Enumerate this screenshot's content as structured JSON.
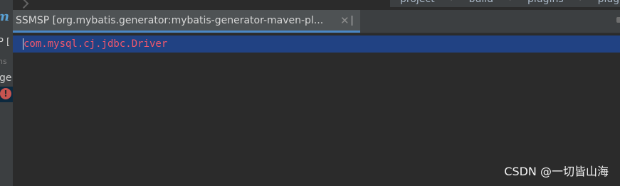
{
  "window": {
    "tab_title": "SSMSP [org.mybatis.generator:mybatis-generator-maven-pl...",
    "tab_close_glyph": "✕"
  },
  "breadcrumbs": [
    {
      "label": "project"
    },
    {
      "label": "build"
    },
    {
      "label": "plugins"
    },
    {
      "label": "plugin"
    }
  ],
  "left_panel": {
    "icon": "maven-icon",
    "fragments": [
      "P [",
      "ns",
      "ge"
    ],
    "error_icon": "error-icon"
  },
  "editor": {
    "lines": [
      {
        "text": "com.mysql.cj.jdbc.Driver",
        "selected": true
      }
    ],
    "colors": {
      "selection": "#214283",
      "text": "#f1586c",
      "background": "#2b2b2b"
    }
  },
  "watermark": "CSDN @一切皆山海"
}
